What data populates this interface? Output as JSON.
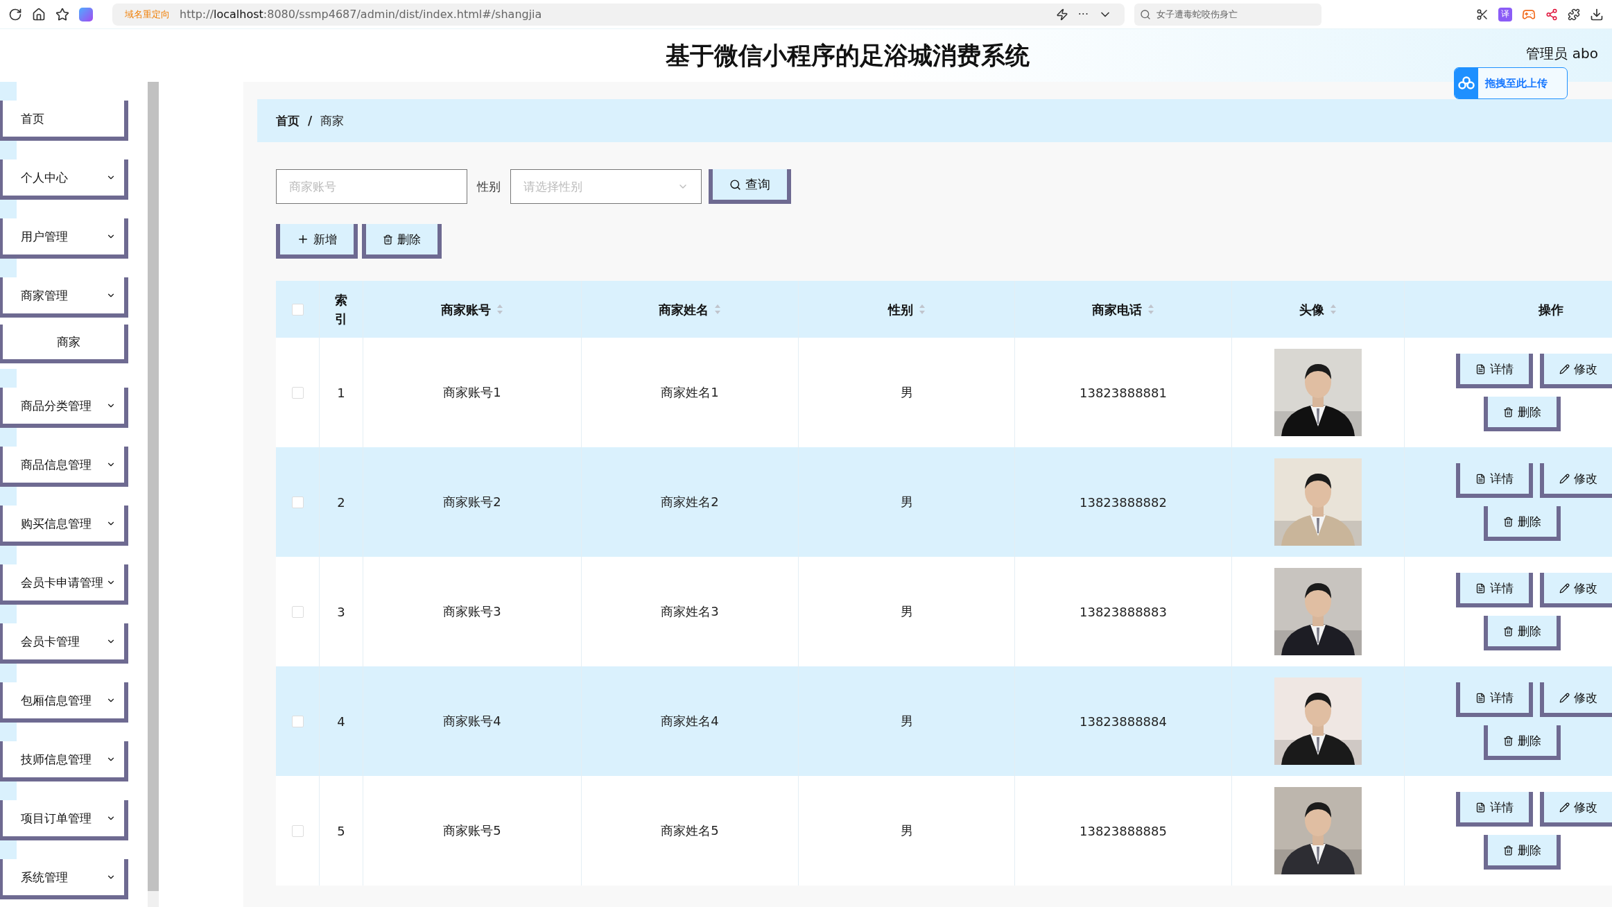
{
  "browser": {
    "redirect_label": "域名重定向",
    "url_host_prefix": "http://",
    "url_host": "localhost",
    "url_rest": ":8080/ssmp4687/admin/dist/index.html#/shangjia",
    "more": "···",
    "search_text": "女子遭毒蛇咬伤身亡",
    "translate_badge": "译"
  },
  "header": {
    "title": "基于微信小程序的足浴城消费系统",
    "user": "管理员 abo",
    "upload_label": "拖拽至此上传"
  },
  "sidebar": {
    "items": [
      {
        "label": "首页",
        "kind": "link"
      },
      {
        "label": "个人中心",
        "kind": "group"
      },
      {
        "label": "用户管理",
        "kind": "group"
      },
      {
        "label": "商家管理",
        "kind": "group",
        "children": [
          {
            "label": "商家"
          }
        ]
      },
      {
        "label": "商品分类管理",
        "kind": "group"
      },
      {
        "label": "商品信息管理",
        "kind": "group"
      },
      {
        "label": "购买信息管理",
        "kind": "group"
      },
      {
        "label": "会员卡申请管理",
        "kind": "group"
      },
      {
        "label": "会员卡管理",
        "kind": "group"
      },
      {
        "label": "包厢信息管理",
        "kind": "group"
      },
      {
        "label": "技师信息管理",
        "kind": "group"
      },
      {
        "label": "项目订单管理",
        "kind": "group"
      },
      {
        "label": "系统管理",
        "kind": "group"
      }
    ]
  },
  "breadcrumb": [
    "首页",
    "商家"
  ],
  "breadcrumb_separator": "/",
  "search": {
    "account_placeholder": "商家账号",
    "gender_label": "性别",
    "gender_placeholder": "请选择性别",
    "query_button": "查询"
  },
  "toolbar": [
    {
      "label": "新增",
      "kind": "add"
    },
    {
      "label": "删除",
      "kind": "delete"
    }
  ],
  "table": {
    "select_all_checked": false,
    "columns": [
      {
        "label": "索引",
        "sortable": false
      },
      {
        "label": "商家账号",
        "sortable": true
      },
      {
        "label": "商家姓名",
        "sortable": true
      },
      {
        "label": "性别",
        "sortable": true
      },
      {
        "label": "商家电话",
        "sortable": true
      },
      {
        "label": "头像",
        "sortable": true
      },
      {
        "label": "操作",
        "sortable": false
      }
    ],
    "rows": [
      {
        "checked": false,
        "index": "1",
        "account": "商家账号1",
        "name": "商家姓名1",
        "gender": "男",
        "phone": "13823888881",
        "actions": [
          {
            "label": "详情",
            "kind": "detail"
          },
          {
            "label": "修改",
            "kind": "edit"
          },
          {
            "label": "删除",
            "kind": "delete"
          }
        ]
      },
      {
        "checked": false,
        "index": "2",
        "account": "商家账号2",
        "name": "商家姓名2",
        "gender": "男",
        "phone": "13823888882",
        "actions": [
          {
            "label": "详情",
            "kind": "detail"
          },
          {
            "label": "修改",
            "kind": "edit"
          },
          {
            "label": "删除",
            "kind": "delete"
          }
        ]
      },
      {
        "checked": false,
        "index": "3",
        "account": "商家账号3",
        "name": "商家姓名3",
        "gender": "男",
        "phone": "13823888883",
        "actions": [
          {
            "label": "详情",
            "kind": "detail"
          },
          {
            "label": "修改",
            "kind": "edit"
          },
          {
            "label": "删除",
            "kind": "delete"
          }
        ]
      },
      {
        "checked": false,
        "index": "4",
        "account": "商家账号4",
        "name": "商家姓名4",
        "gender": "男",
        "phone": "13823888884",
        "actions": [
          {
            "label": "详情",
            "kind": "detail"
          },
          {
            "label": "修改",
            "kind": "edit"
          },
          {
            "label": "删除",
            "kind": "delete"
          }
        ]
      },
      {
        "checked": false,
        "index": "5",
        "account": "商家账号5",
        "name": "商家姓名5",
        "gender": "男",
        "phone": "13823888885",
        "actions": [
          {
            "label": "详情",
            "kind": "detail"
          },
          {
            "label": "修改",
            "kind": "edit"
          },
          {
            "label": "删除",
            "kind": "delete"
          }
        ]
      }
    ]
  }
}
